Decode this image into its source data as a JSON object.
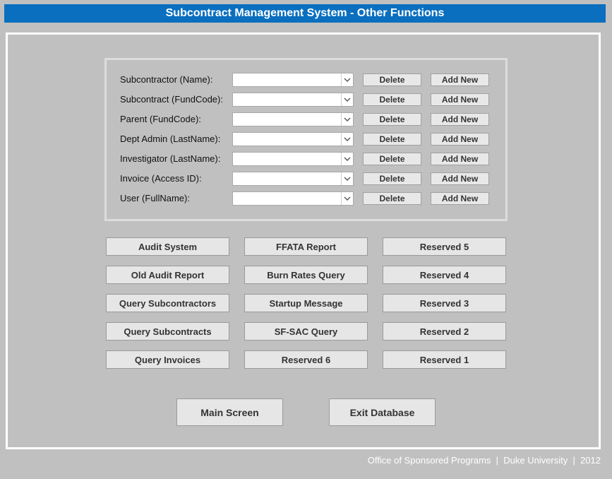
{
  "window": {
    "title": "Subcontract Management System - Other Functions"
  },
  "lookups": [
    {
      "label": "Subcontractor (Name):",
      "value": "",
      "delete_label": "Delete",
      "add_label": "Add New"
    },
    {
      "label": "Subcontract (FundCode):",
      "value": "",
      "delete_label": "Delete",
      "add_label": "Add New"
    },
    {
      "label": "Parent (FundCode):",
      "value": "",
      "delete_label": "Delete",
      "add_label": "Add New"
    },
    {
      "label": "Dept Admin (LastName):",
      "value": "",
      "delete_label": "Delete",
      "add_label": "Add New"
    },
    {
      "label": "Investigator (LastName):",
      "value": "",
      "delete_label": "Delete",
      "add_label": "Add New"
    },
    {
      "label": "Invoice (Access ID):",
      "value": "",
      "delete_label": "Delete",
      "add_label": "Add New"
    },
    {
      "label": "User (FullName):",
      "value": "",
      "delete_label": "Delete"
    }
  ],
  "functions": {
    "col1": [
      "Audit System",
      "Old Audit Report",
      "Query Subcontractors",
      "Query Subcontracts",
      "Query Invoices"
    ],
    "col2": [
      "FFATA Report",
      "Burn Rates Query",
      "Startup Message",
      "SF-SAC Query",
      "Reserved 6"
    ],
    "col3": [
      "Reserved 5",
      "Reserved 4",
      "Reserved 3",
      "Reserved 2",
      "Reserved 1"
    ]
  },
  "nav": {
    "main_screen": "Main Screen",
    "exit_database": "Exit Database"
  },
  "footer": {
    "text": "Office of Sponsored Programs  |  Duke University  |  2012"
  }
}
